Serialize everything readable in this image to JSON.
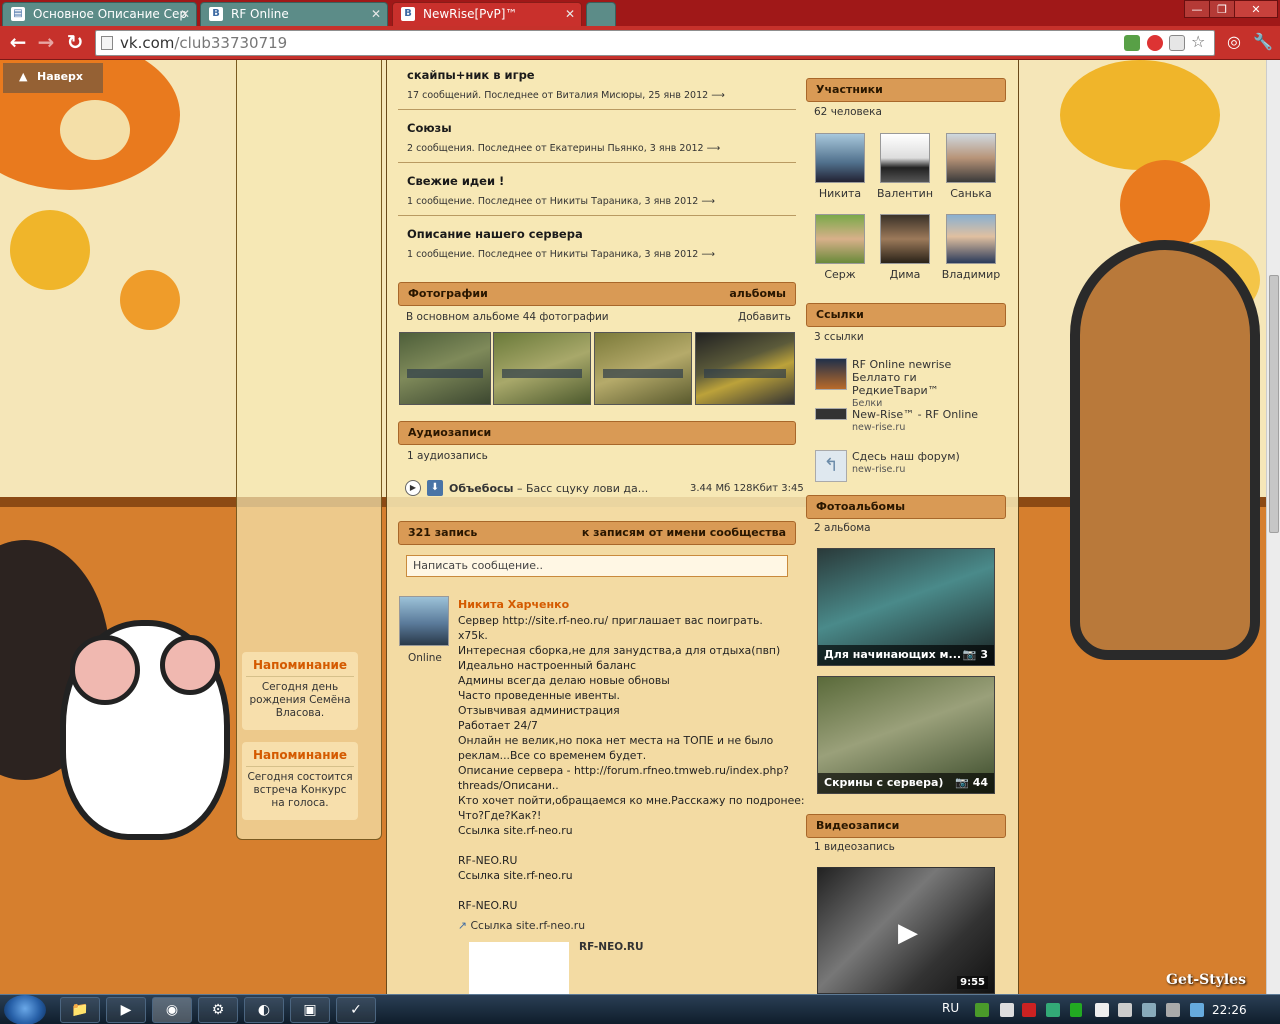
{
  "browser": {
    "tabs": [
      {
        "label": "Основное Описание Сер",
        "icon": "page-icon"
      },
      {
        "label": "RF Online",
        "icon": "vk-icon"
      },
      {
        "label": "NewRise[PvP]™",
        "icon": "vk-icon"
      }
    ],
    "url_host": "vk.com",
    "url_path": "/club33730719"
  },
  "page": {
    "back_to_top": "Наверх",
    "topics": [
      {
        "title": "скайпы+ник в игре",
        "meta": "17 сообщений. Последнее от Виталия Мисюры, 25 янв 2012  ⟶"
      },
      {
        "title": "Союзы",
        "meta": "2 сообщения. Последнее от Екатерины Пьянко, 3 янв 2012  ⟶"
      },
      {
        "title": "Свежие идеи !",
        "meta": "1 сообщение. Последнее от Никиты Тараника, 3 янв 2012  ⟶"
      },
      {
        "title": "Описание нашего сервера",
        "meta": "1 сообщение. Последнее от Никиты Тараника, 3 янв 2012  ⟶"
      }
    ],
    "photos": {
      "header": "Фотографии",
      "header_link": "альбомы",
      "summary": "В основном альбоме 44 фотографии",
      "add": "Добавить"
    },
    "audio": {
      "header": "Аудиозаписи",
      "count": "1 аудиозапись",
      "artist": "Объебосы",
      "title": "– Басс сцуку лови да...",
      "meta": "3.44 Мб 128Кбит 3:45"
    },
    "wall": {
      "header": "321 запись",
      "header_link": "к записям от имени сообщества",
      "placeholder": "Написать сообщение..",
      "post": {
        "author": "Никита Харченко",
        "status": "Online",
        "lines": [
          "Сервер http://site.rf-neo.ru/ приглашает вас поиграть.",
          "x75k.",
          "Интересная сборка,не для занудства,а для отдыха(пвп)",
          "Идеально настроенный баланс",
          "Админы всегда делаю новые обновы",
          "Часто проведенные ивенты.",
          "Отзывчивая администрация",
          "Работает 24/7",
          "Онлайн не велик,но пока нет места на ТОПЕ и не было",
          "реклам...Все со временем будет.",
          "Описание сервера - http://forum.rfneo.tmweb.ru/index.php?",
          "threads/Описани..",
          "Кто хочет пойти,обращаемся ко мне.Расскажу по подронее:",
          "Что?Где?Как?!",
          "Ссылка site.rf-neo.ru",
          "",
          "RF-NEO.RU",
          "Ссылка site.rf-neo.ru",
          "",
          "RF-NEO.RU"
        ],
        "attach_link": "Ссылка site.rf-neo.ru",
        "attach_title": "RF-NEO.RU"
      }
    },
    "reminders": [
      {
        "title": "Напоминание",
        "body": "Сегодня день рождения Семёна Власова."
      },
      {
        "title": "Напоминание",
        "body": "Сегодня состоится встреча Конкурс на голоса."
      }
    ],
    "members": {
      "header": "Участники",
      "count": "62 человека",
      "people": [
        "Никита",
        "Валентин",
        "Санька",
        "Серж",
        "Дима",
        "Владимир"
      ]
    },
    "links": {
      "header": "Ссылки",
      "count": "3 ссылки",
      "items": [
        {
          "title": "RF Online newrise Беллато ги РедкиеТвари™",
          "desc": "Белки"
        },
        {
          "title": "New-Rise™ - RF Online",
          "desc": "new-rise.ru"
        },
        {
          "title": "Сдесь наш форум)",
          "desc": "new-rise.ru"
        }
      ]
    },
    "albums": {
      "header": "Фотоальбомы",
      "count": "2 альбома",
      "items": [
        {
          "title": "Для начинающих м...",
          "count": "3"
        },
        {
          "title": "Скрины с сервера)",
          "count": "44"
        }
      ]
    },
    "videos": {
      "header": "Видеозаписи",
      "count": "1 видеозапись",
      "duration": "9:55"
    },
    "watermark": "Get-Styles"
  },
  "taskbar": {
    "lang": "RU",
    "time": "22:26"
  },
  "colors": {
    "chrome_red": "#c6312b",
    "section_header": "#d99a55",
    "author_link": "#d45a00"
  }
}
